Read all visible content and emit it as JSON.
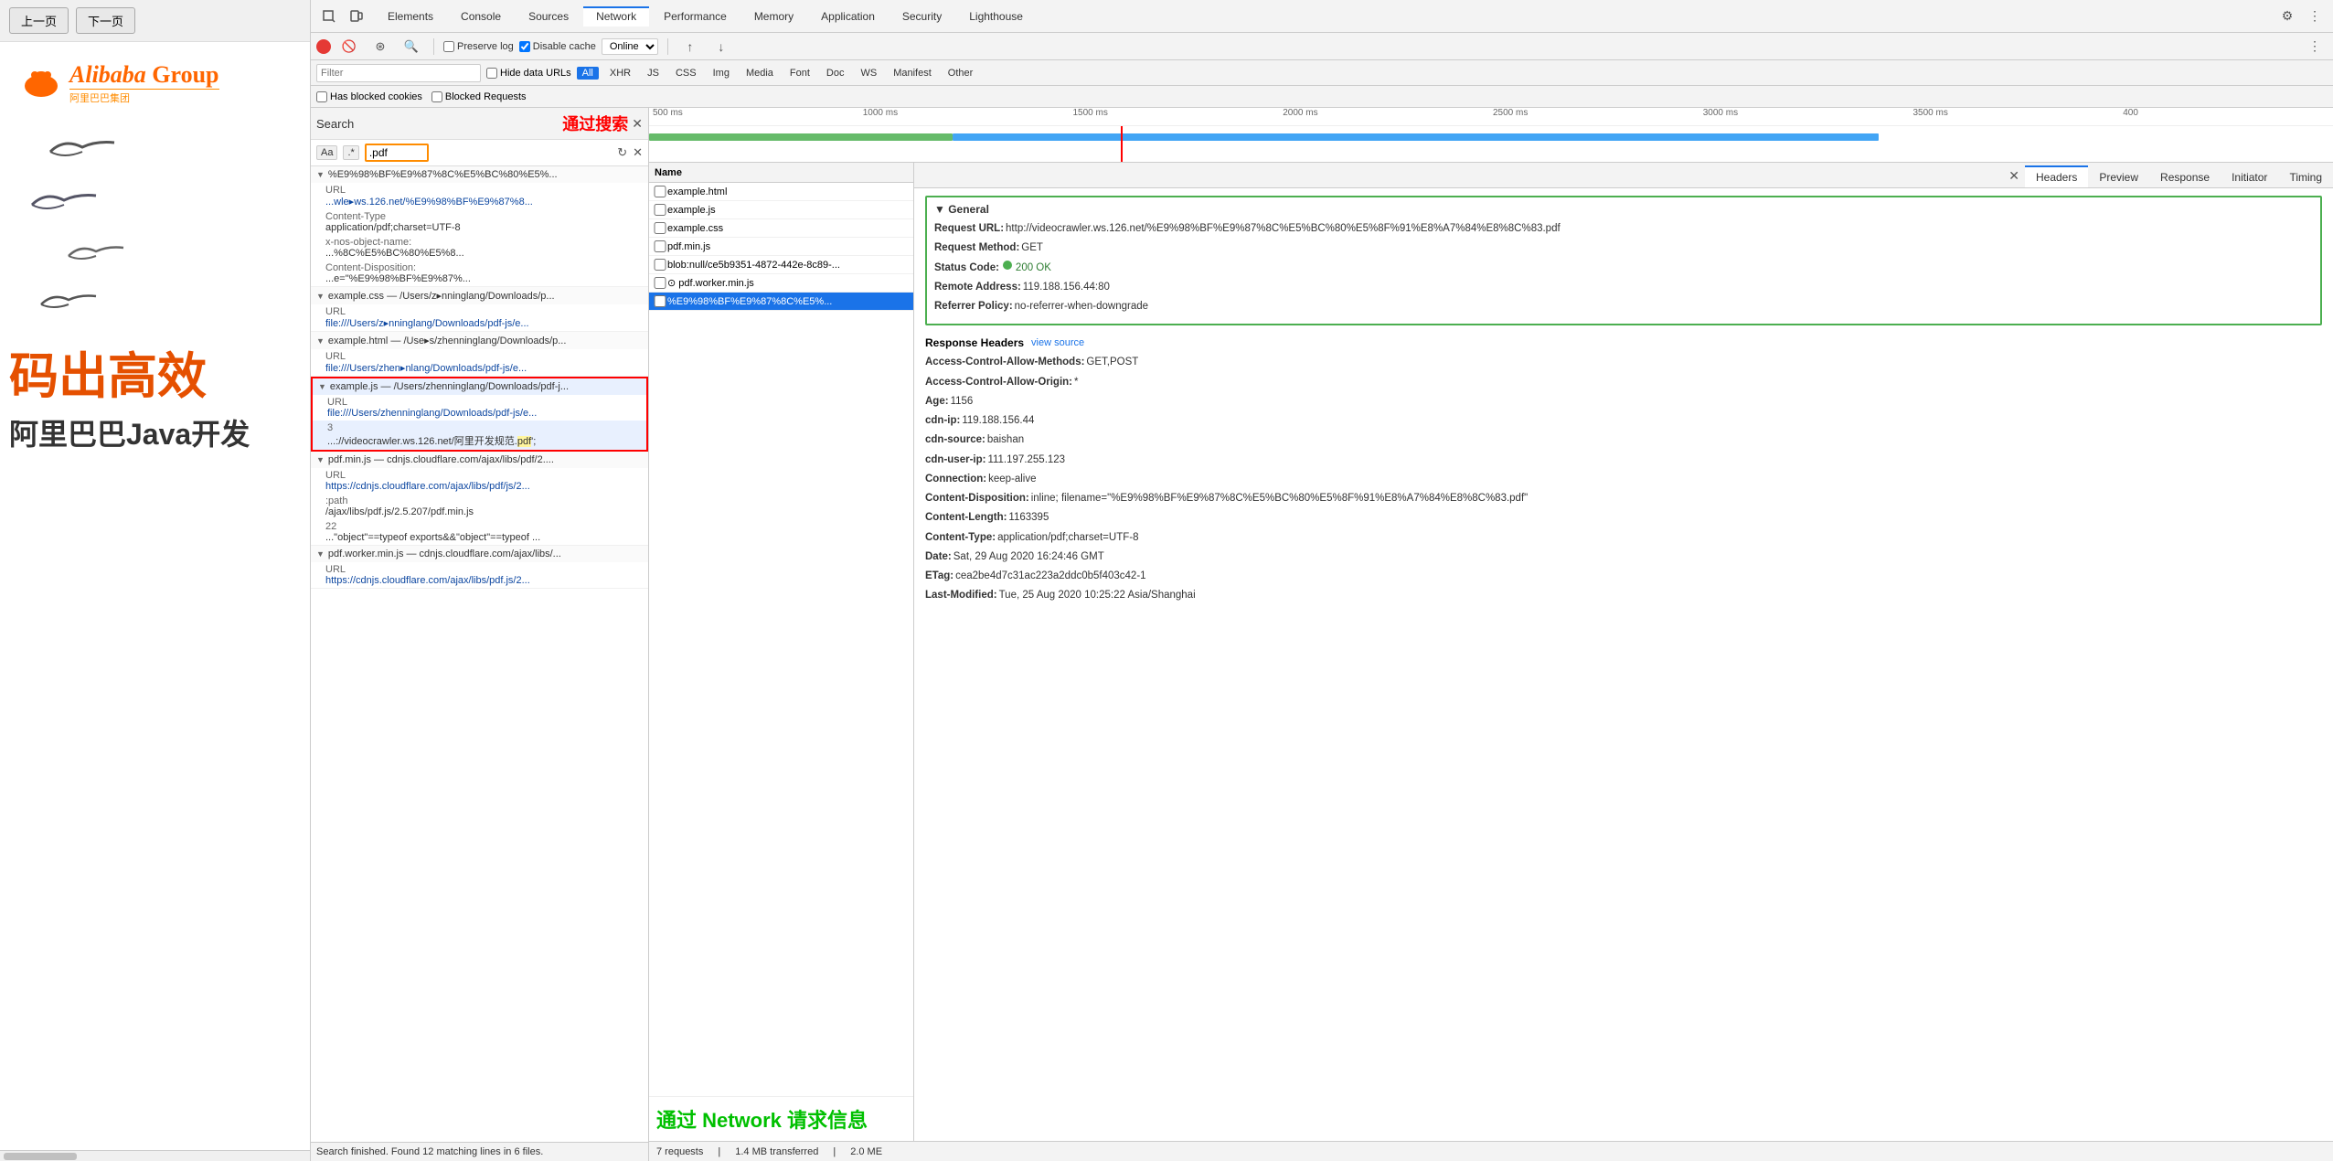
{
  "webpage": {
    "nav": {
      "prev_label": "上一页",
      "next_label": "下一页"
    },
    "logo": {
      "text": "Alibaba Group",
      "sub": "阿里巴巴集团"
    },
    "bottom_title": "码出高效",
    "bottom_subtitle": "阿里巴巴Java开发"
  },
  "devtools": {
    "tabs": [
      {
        "label": "Elements"
      },
      {
        "label": "Console"
      },
      {
        "label": "Sources"
      },
      {
        "label": "Network"
      },
      {
        "label": "Performance"
      },
      {
        "label": "Memory"
      },
      {
        "label": "Application"
      },
      {
        "label": "Security"
      },
      {
        "label": "Lighthouse"
      }
    ],
    "active_tab": "Network",
    "network": {
      "controls": {
        "preserve_log": "Preserve log",
        "disable_cache": "Disable cache",
        "online": "Online"
      },
      "filter": {
        "placeholder": "Filter",
        "hide_data_urls": "Hide data URLs",
        "types": [
          "All",
          "XHR",
          "JS",
          "CSS",
          "Img",
          "Media",
          "Font",
          "Doc",
          "WS",
          "Manifest",
          "Other"
        ],
        "active_type": "All",
        "has_blocked_cookies": "Has blocked cookies",
        "blocked_requests": "Blocked Requests"
      },
      "timeline": {
        "ticks": [
          "500 ms",
          "1000 ms",
          "1500 ms",
          "2000 ms",
          "2500 ms",
          "3000 ms",
          "3500 ms",
          "400"
        ]
      },
      "list": {
        "header": "Name",
        "items": [
          {
            "name": "example.html",
            "checked": false
          },
          {
            "name": "example.js",
            "checked": false
          },
          {
            "name": "example.css",
            "checked": false
          },
          {
            "name": "pdf.min.js",
            "checked": false
          },
          {
            "name": "blob:null/ce5b9351-4872-442e-8c89-...",
            "checked": false
          },
          {
            "name": "⊙ pdf.worker.min.js",
            "checked": false
          },
          {
            "name": "%E9%98%BF%E9%87%8C%E5%...",
            "checked": false,
            "selected": true
          }
        ]
      },
      "details": {
        "tabs": [
          "Headers",
          "Preview",
          "Response",
          "Initiator",
          "Timing"
        ],
        "active_tab": "Headers",
        "general": {
          "title": "▼ General",
          "request_url_key": "Request URL:",
          "request_url_val": "http://videocrawler.ws.126.net/%E9%98%BF%E9%87%8C%E5%BC%80%E5%8F%91%E8%A7%84%E8%8C%83.pdf",
          "request_method_key": "Request Method:",
          "request_method_val": "GET",
          "status_code_key": "Status Code:",
          "status_code_val": "200 OK",
          "remote_address_key": "Remote Address:",
          "remote_address_val": "119.188.156.44:80",
          "referrer_policy_key": "Referrer Policy:",
          "referrer_policy_val": "no-referrer-when-downgrade"
        },
        "response_headers": {
          "title": "Response Headers",
          "view_source": "view source",
          "items": [
            {
              "key": "Access-Control-Allow-Methods:",
              "val": "GET,POST"
            },
            {
              "key": "Access-Control-Allow-Origin:",
              "val": "*"
            },
            {
              "key": "Age:",
              "val": "1156"
            },
            {
              "key": "cdn-ip:",
              "val": "119.188.156.44"
            },
            {
              "key": "cdn-source:",
              "val": "baishan"
            },
            {
              "key": "cdn-user-ip:",
              "val": "111.197.255.123"
            },
            {
              "key": "Connection:",
              "val": "keep-alive"
            },
            {
              "key": "Content-Disposition:",
              "val": "inline; filename=\"%E9%98%BF%E9%87%8C%E5%BC%80%E5%8F%91%E8%A7%84%E8%8C%83.pdf\""
            },
            {
              "key": "Content-Length:",
              "val": "1163395"
            },
            {
              "key": "Content-Type:",
              "val": "application/pdf;charset=UTF-8"
            },
            {
              "key": "Date:",
              "val": "Sat, 29 Aug 2020 16:24:46 GMT"
            },
            {
              "key": "ETag:",
              "val": "cea2be4d7c31ac223a2ddc0b5f403c42-1"
            },
            {
              "key": "Last-Modified:",
              "val": "Tue, 25 Aug 2020 10:25:22 Asia/Shanghai"
            }
          ]
        }
      },
      "statusbar": {
        "requests": "7 requests",
        "transferred": "1.4 MB transferred",
        "size": "2.0 ME"
      }
    },
    "search": {
      "label": "Search",
      "annotation": "通过搜索",
      "options": {
        "aa": "Aa",
        "dot": ".*"
      },
      "input_value": ".pdf",
      "status": "Search finished. Found 12 matching lines in 6 files.",
      "results": [
        {
          "id": "group1",
          "title": "▼ %E9%98%BF%E9%87%8C%E5%BC%80%E5%...",
          "items": [
            {
              "key": "URL",
              "val": "...wle▸ws.126.net/%E9%98%BF%E9%87%8..."
            },
            {
              "key": "Content-Type",
              "val": "application/pdf;charset=UTF-8"
            },
            {
              "key": "x-nos-object-name:",
              "val": "...%8C%E5%BC%80%E5%8..."
            },
            {
              "key": "Content-Disposition:",
              "val": "...e=\"%E9%98%BF%E9%87%..."
            }
          ]
        },
        {
          "id": "group2",
          "title": "▼ example.css — /Users/z▸nninglang/Downloads/p...",
          "items": [
            {
              "key": "URL",
              "val": "file:///Users/z▸nninglang/Downloads/pdf-js/e..."
            }
          ]
        },
        {
          "id": "group3",
          "title": "▼ example.html — /Use▸s/zhenninglang/Downloads/p...",
          "items": [
            {
              "key": "URL",
              "val": "file:///Users/zhen▸nlang/Downloads/pdf-js/e..."
            }
          ]
        },
        {
          "id": "group4",
          "title": "▼ example.js — /Users/zhenninglang/Downloads/pdf-j...",
          "selected": true,
          "items": [
            {
              "key": "URL",
              "val": "file:///Users/zhenninglang/Downloads/pdf-js/e..."
            },
            {
              "key": "3",
              "val": "...://videocrawler.ws.126.net/阿里开发规范.pdf';",
              "highlight": true
            }
          ]
        },
        {
          "id": "group5",
          "title": "▼ pdf.min.js — cdnjs.cloudflare.com/ajax/libs/pdf/2....",
          "items": [
            {
              "key": "URL",
              "val": "https://cdnjs.cloudflare.com/ajax/libs/pdf/js/2..."
            },
            {
              "key": ":path",
              "val": "/ajax/libs/pdf.js/2.5.207/pdf.min.js"
            },
            {
              "key": "22",
              "val": "...\"object\"==typeof exports&&\"object\"==typeof ..."
            }
          ]
        },
        {
          "id": "group6",
          "title": "▼ pdf.worker.min.js — cdnjs.cloudflare.com/ajax/libs/...",
          "items": [
            {
              "key": "URL",
              "val": "https://cdnjs.cloudflare.com/ajax/libs/pdf.js/2..."
            }
          ]
        }
      ]
    }
  },
  "annotations": {
    "search_annotation": "通过搜索",
    "network_annotation": "通过 Network 请求信息"
  }
}
